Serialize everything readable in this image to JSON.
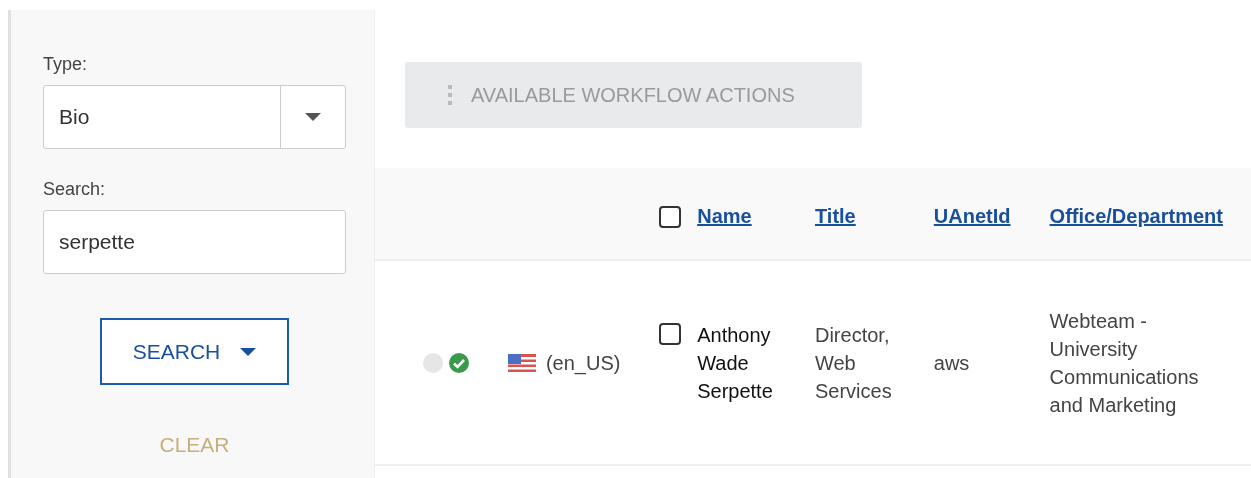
{
  "filter": {
    "type_label": "Type:",
    "type_value": "Bio",
    "search_label": "Search:",
    "search_value": "serpette",
    "search_button": "SEARCH",
    "clear_button": "CLEAR"
  },
  "actions_button": {
    "label": "AVAILABLE WORKFLOW ACTIONS",
    "disabled": true
  },
  "table": {
    "select_all_checked": false,
    "columns": [
      "Name",
      "Title",
      "UAnetId",
      "Office/Department"
    ],
    "rows": [
      {
        "approved": true,
        "locale": "(en_US)",
        "checked": false,
        "name": "Anthony Wade Serpette",
        "title": "Director, Web Services",
        "uanetid": "aws",
        "office": "Webteam - University Communications and Marketing"
      }
    ]
  }
}
